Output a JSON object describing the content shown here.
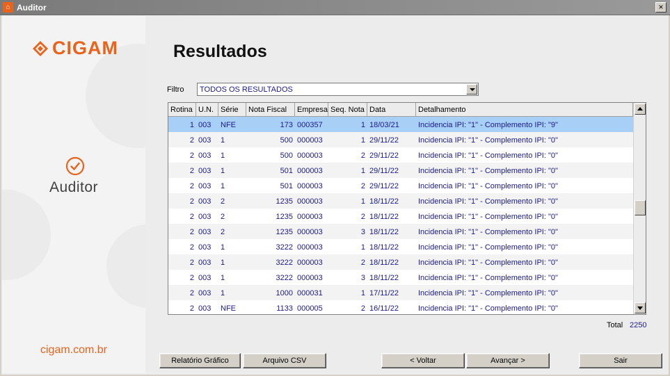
{
  "window": {
    "title": "Auditor",
    "close_glyph": "×"
  },
  "sidebar": {
    "brand": "CIGAM",
    "product": "Auditor",
    "website": "cigam.com.br",
    "brand_color": "#e8631c",
    "logo_icon": "cigam-logo-icon",
    "status_icon": "check-circle-icon"
  },
  "main": {
    "heading": "Resultados",
    "filter": {
      "label": "Filtro",
      "value": "TODOS OS RESULTADOS"
    }
  },
  "grid": {
    "columns": [
      "Rotina",
      "U.N.",
      "Série",
      "Nota Fiscal",
      "Empresa",
      "Seq. Nota",
      "Data",
      "Detalhamento"
    ],
    "rows": [
      [
        "1",
        "003",
        "NFE",
        "173",
        "000357",
        "1",
        "18/03/21",
        "Incidencia IPI: \"1\" - Complemento IPI: \"9\""
      ],
      [
        "2",
        "003",
        "1",
        "500",
        "000003",
        "1",
        "29/11/22",
        "Incidencia IPI: \"1\" - Complemento IPI: \"0\""
      ],
      [
        "2",
        "003",
        "1",
        "500",
        "000003",
        "2",
        "29/11/22",
        "Incidencia IPI: \"1\" - Complemento IPI: \"0\""
      ],
      [
        "2",
        "003",
        "1",
        "501",
        "000003",
        "1",
        "29/11/22",
        "Incidencia IPI: \"1\" - Complemento IPI: \"0\""
      ],
      [
        "2",
        "003",
        "1",
        "501",
        "000003",
        "2",
        "29/11/22",
        "Incidencia IPI: \"1\" - Complemento IPI: \"0\""
      ],
      [
        "2",
        "003",
        "2",
        "1235",
        "000003",
        "1",
        "18/11/22",
        "Incidencia IPI: \"1\" - Complemento IPI: \"0\""
      ],
      [
        "2",
        "003",
        "2",
        "1235",
        "000003",
        "2",
        "18/11/22",
        "Incidencia IPI: \"1\" - Complemento IPI: \"0\""
      ],
      [
        "2",
        "003",
        "2",
        "1235",
        "000003",
        "3",
        "18/11/22",
        "Incidencia IPI: \"1\" - Complemento IPI: \"0\""
      ],
      [
        "2",
        "003",
        "1",
        "3222",
        "000003",
        "1",
        "18/11/22",
        "Incidencia IPI: \"1\" - Complemento IPI: \"0\""
      ],
      [
        "2",
        "003",
        "1",
        "3222",
        "000003",
        "2",
        "18/11/22",
        "Incidencia IPI: \"1\" - Complemento IPI: \"0\""
      ],
      [
        "2",
        "003",
        "1",
        "3222",
        "000003",
        "3",
        "18/11/22",
        "Incidencia IPI: \"1\" - Complemento IPI: \"0\""
      ],
      [
        "2",
        "003",
        "1",
        "1000",
        "000031",
        "1",
        "17/11/22",
        "Incidencia IPI: \"1\" - Complemento IPI: \"0\""
      ],
      [
        "2",
        "003",
        "NFE",
        "1133",
        "000005",
        "2",
        "16/11/22",
        "Incidencia IPI: \"1\" - Complemento IPI: \"0\""
      ]
    ],
    "selected_row": 0
  },
  "total": {
    "label": "Total",
    "value": "2250"
  },
  "buttons": {
    "relatorio": "Relatório Gráfico",
    "csv": "Arquivo CSV",
    "voltar": "< Voltar",
    "avancar": "Avançar >",
    "sair": "Sair"
  }
}
